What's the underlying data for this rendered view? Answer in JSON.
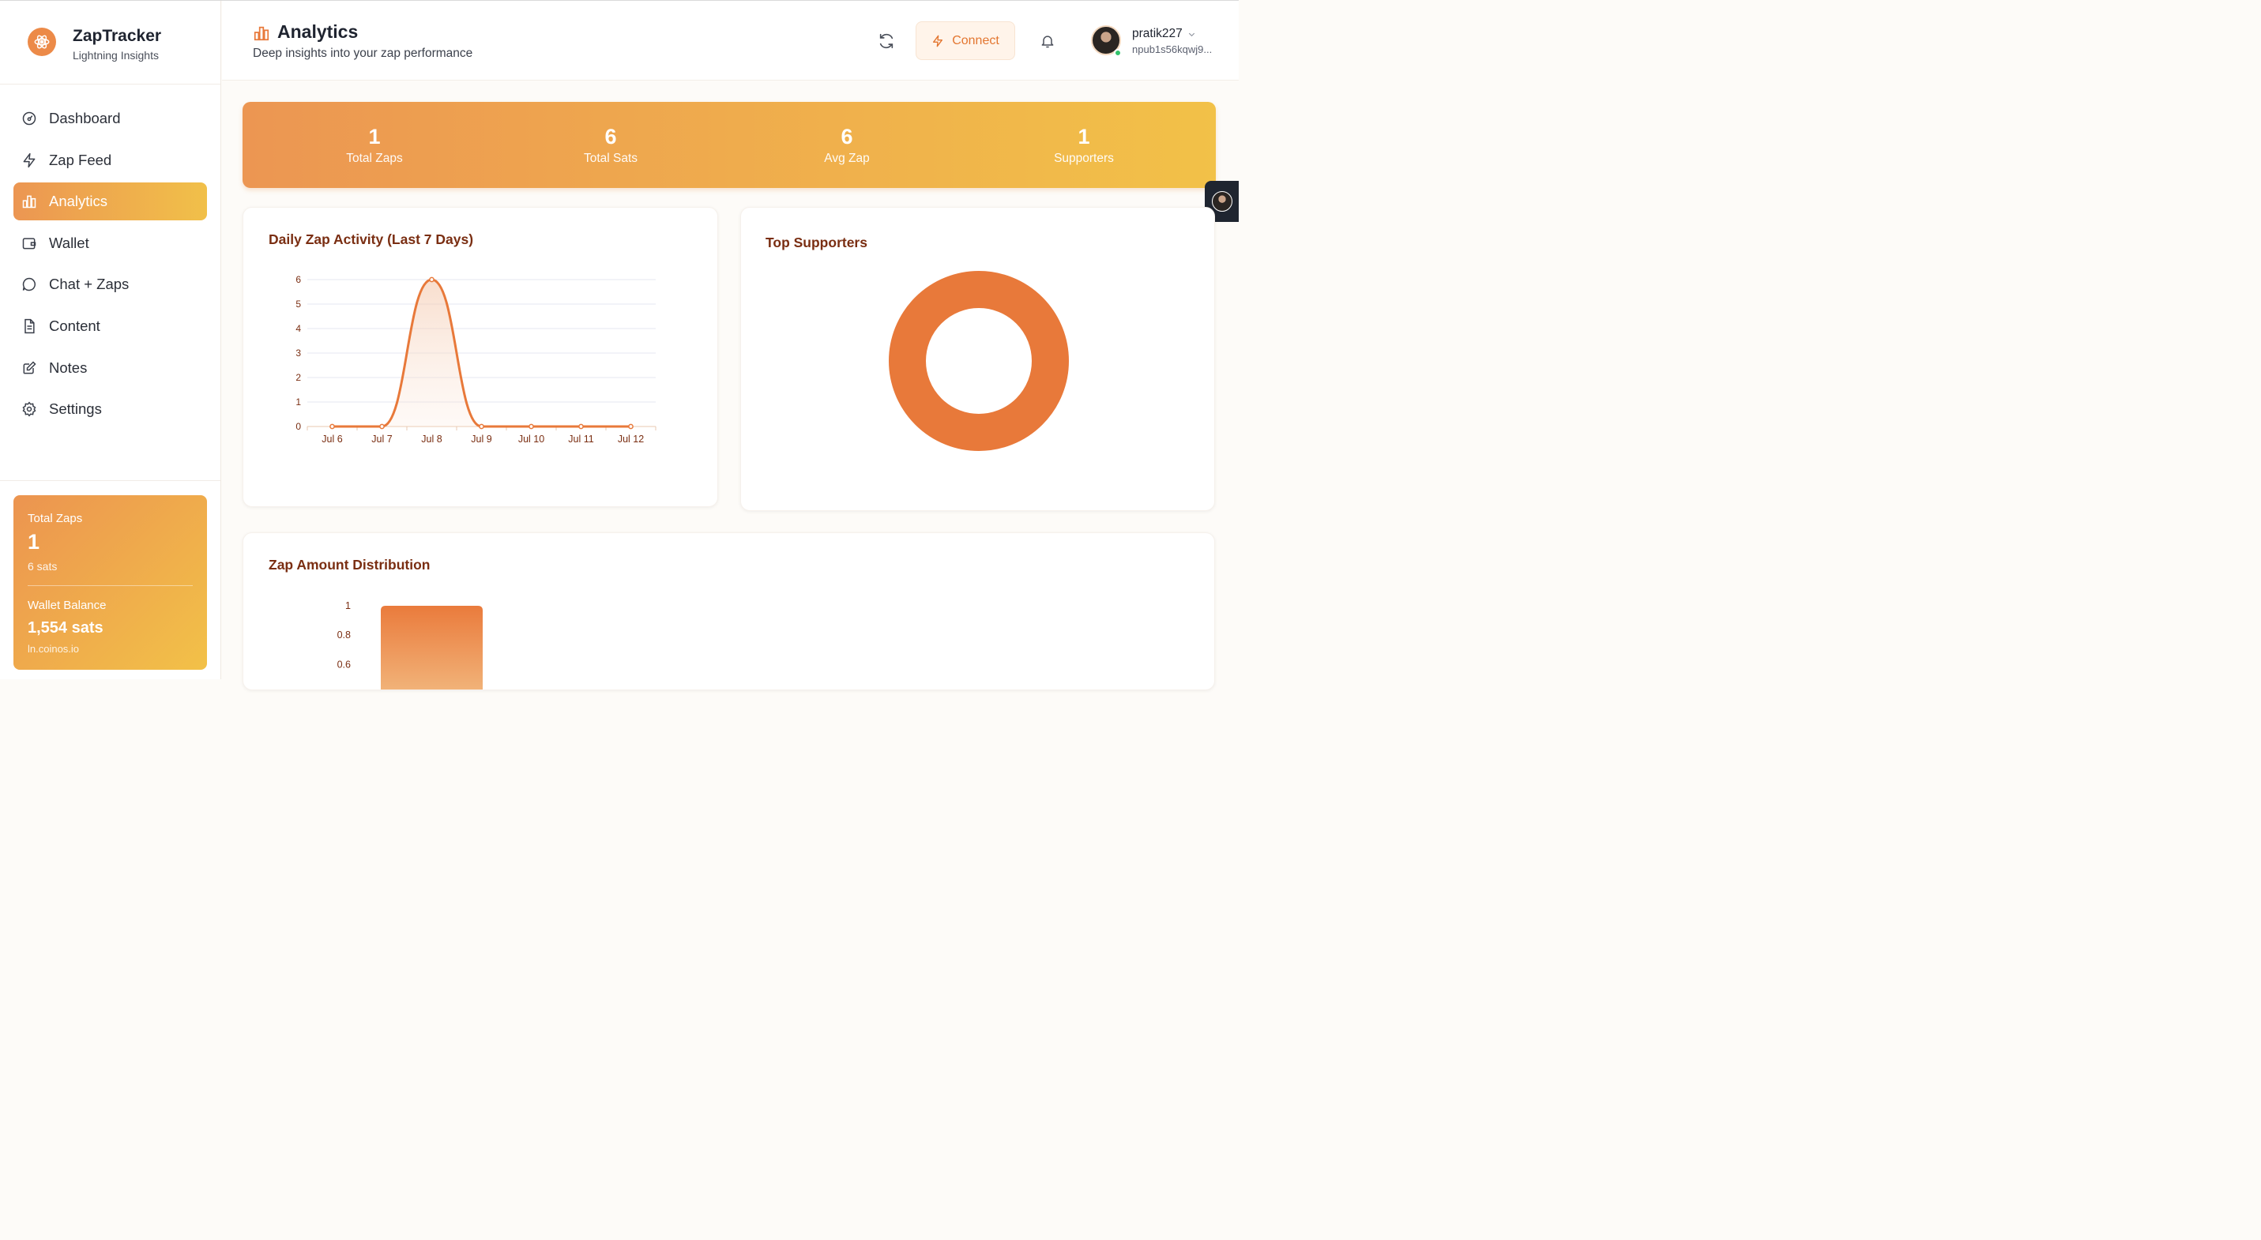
{
  "brand": {
    "title": "ZapTracker",
    "subtitle": "Lightning Insights"
  },
  "nav": [
    {
      "label": "Dashboard",
      "icon": "gauge-icon",
      "active": false
    },
    {
      "label": "Zap Feed",
      "icon": "zap-icon",
      "active": false
    },
    {
      "label": "Analytics",
      "icon": "bar-chart-icon",
      "active": true
    },
    {
      "label": "Wallet",
      "icon": "wallet-icon",
      "active": false
    },
    {
      "label": "Chat + Zaps",
      "icon": "chat-icon",
      "active": false
    },
    {
      "label": "Content",
      "icon": "document-icon",
      "active": false
    },
    {
      "label": "Notes",
      "icon": "edit-icon",
      "active": false
    },
    {
      "label": "Settings",
      "icon": "gear-icon",
      "active": false
    }
  ],
  "sidebar_card": {
    "total_zaps_label": "Total Zaps",
    "total_zaps_value": "1",
    "total_sats": "6 sats",
    "wallet_label": "Wallet Balance",
    "wallet_value": "1,554 sats",
    "wallet_host": "ln.coinos.io"
  },
  "header": {
    "title": "Analytics",
    "subtitle": "Deep insights into your zap performance",
    "connect_label": "Connect",
    "user_name": "pratik227",
    "user_npub": "npub1s56kqwj9..."
  },
  "stats": [
    {
      "value": "1",
      "label": "Total Zaps"
    },
    {
      "value": "6",
      "label": "Total Sats"
    },
    {
      "value": "6",
      "label": "Avg Zap"
    },
    {
      "value": "1",
      "label": "Supporters"
    }
  ],
  "cards": {
    "daily_title": "Daily Zap Activity (Last 7 Days)",
    "supporters_title": "Top Supporters",
    "distribution_title": "Zap Amount Distribution"
  },
  "colors": {
    "accent": "#E8793A",
    "gradient_start": "#EC9652",
    "gradient_end": "#F2C148",
    "title": "#7A2E12"
  },
  "chart_data": [
    {
      "type": "line",
      "title": "Daily Zap Activity (Last 7 Days)",
      "categories": [
        "Jul 6",
        "Jul 7",
        "Jul 8",
        "Jul 9",
        "Jul 10",
        "Jul 11",
        "Jul 12"
      ],
      "values": [
        0,
        0,
        6,
        0,
        0,
        0,
        0
      ],
      "ylim": [
        0,
        6
      ],
      "yticks": [
        0,
        1,
        2,
        3,
        4,
        5,
        6
      ],
      "grid": true,
      "smooth": true,
      "fill": true
    },
    {
      "type": "pie",
      "title": "Top Supporters",
      "donut": true,
      "values": [
        6
      ]
    },
    {
      "type": "bar",
      "title": "Zap Amount Distribution",
      "values": [
        1
      ],
      "yticks_visible": [
        "1",
        "0.8",
        "0.6"
      ],
      "ylim": [
        0,
        1
      ]
    }
  ]
}
